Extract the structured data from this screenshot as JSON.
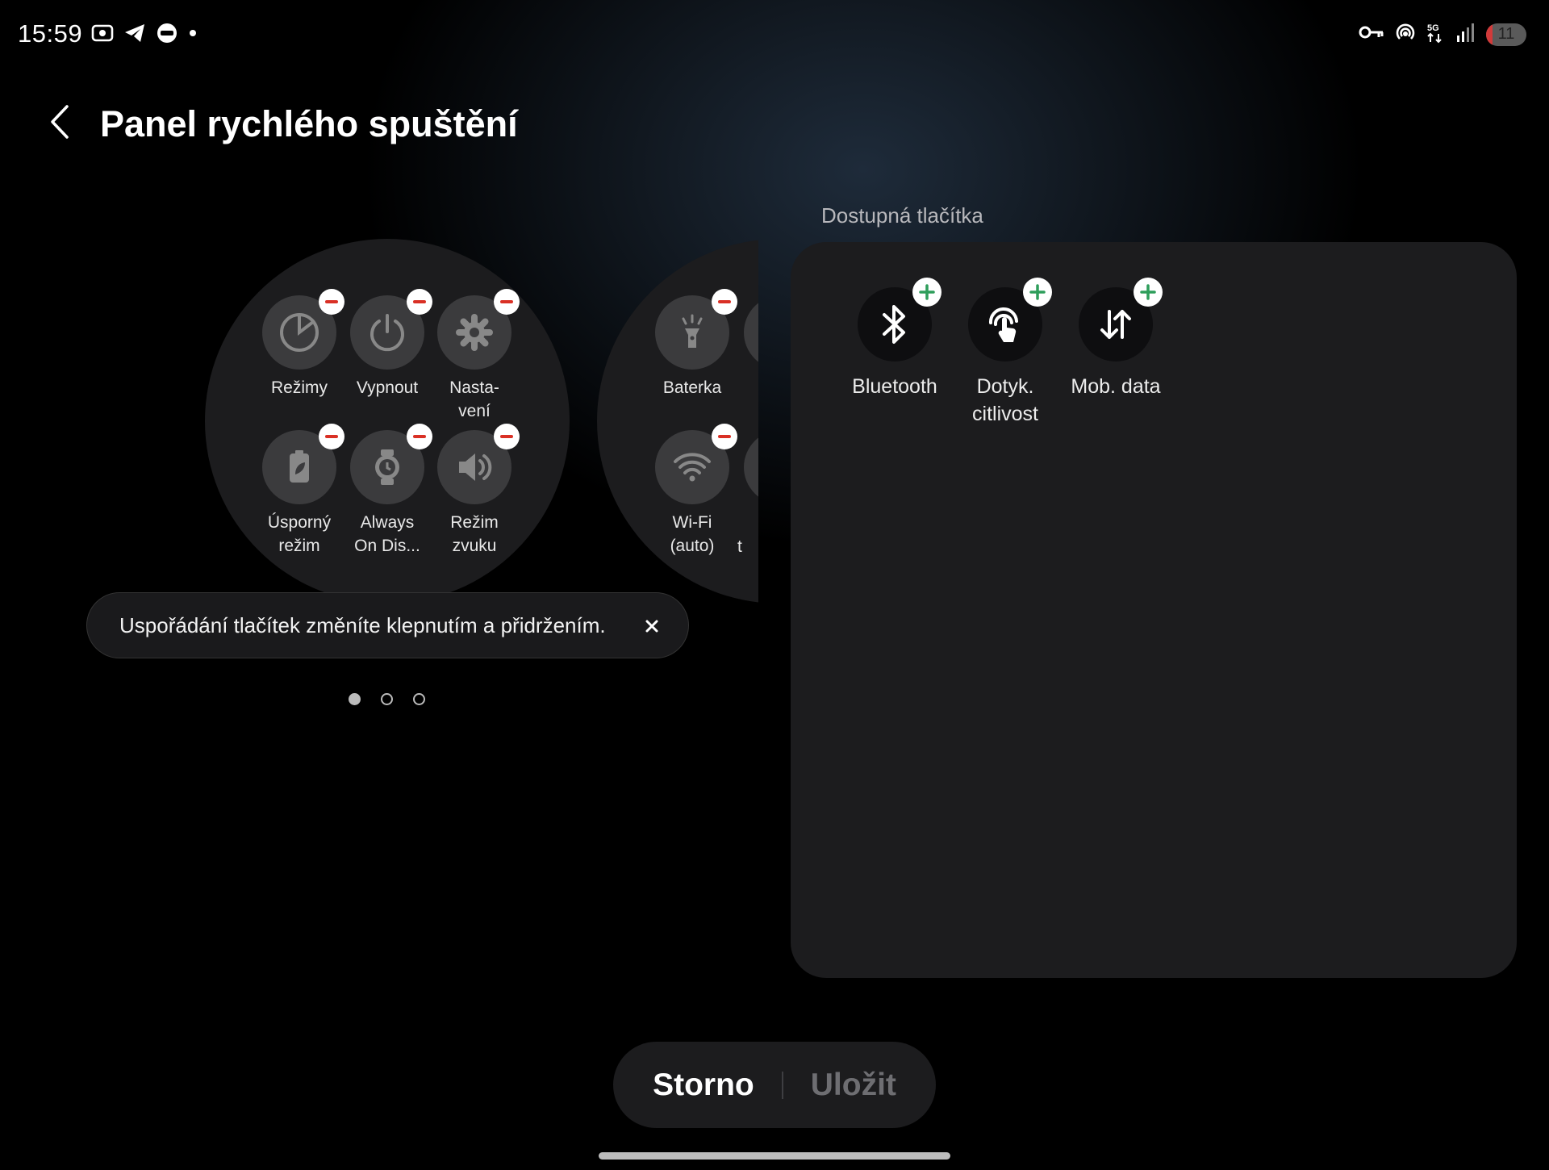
{
  "status_bar": {
    "time": "15:59",
    "battery_level": "11"
  },
  "header": {
    "title": "Panel rychlého spuštění"
  },
  "page1": {
    "tiles": [
      {
        "label": "Režimy",
        "icon": "modes-icon"
      },
      {
        "label": "Vypnout",
        "icon": "power-icon"
      },
      {
        "label": "Nasta-\nvení",
        "icon": "gear-icon"
      },
      {
        "label": "Úsporný\nrežim",
        "icon": "battery-saver-icon"
      },
      {
        "label": "Always\nOn Dis...",
        "icon": "watch-icon"
      },
      {
        "label": "Režim\nzvuku",
        "icon": "speaker-icon"
      }
    ]
  },
  "page2": {
    "tiles": [
      {
        "label": "Baterka",
        "icon": "flashlight-icon"
      },
      {
        "label": "Wi-Fi\n(auto)",
        "icon": "wifi-icon"
      },
      {
        "label": "t",
        "icon": "partial-icon"
      }
    ]
  },
  "available": {
    "title": "Dostupná tlačítka",
    "tiles": [
      {
        "label": "Bluetooth",
        "icon": "bluetooth-icon"
      },
      {
        "label": "Dotyk.\ncitlivost",
        "icon": "touch-sensitivity-icon"
      },
      {
        "label": "Mob. data",
        "icon": "mobile-data-icon"
      }
    ]
  },
  "toast": {
    "text": "Uspořádání tlačítek změníte klepnutím a přidržením."
  },
  "pager": {
    "pages": 3,
    "current": 1
  },
  "actions": {
    "cancel_label": "Storno",
    "save_label": "Uložit"
  },
  "colors": {
    "minus_badge": "#d93025",
    "plus_badge": "#2e9e5b",
    "panel_bg": "#1c1c1e"
  }
}
